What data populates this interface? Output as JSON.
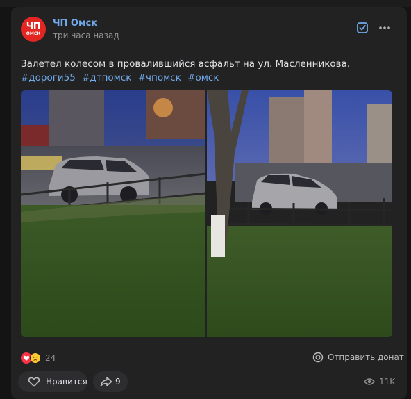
{
  "post": {
    "author": "ЧП Омск",
    "avatar_text": "ЧП",
    "avatar_subtext": "ОМСК",
    "time": "три часа назад",
    "text": "Залетел колесом в провалившийся асфальт на ул. Масленникова.",
    "hashtags": [
      "#дороги55",
      "#дтпомск",
      "#чпомск",
      "#омск"
    ]
  },
  "header_icons": [
    "save-check-icon",
    "more-dots-icon"
  ],
  "reactions": {
    "count": "24",
    "icons": [
      "heart-icon",
      "sad-emoji-icon"
    ]
  },
  "donate": {
    "label": "Отправить донат",
    "icon": "coin-icon"
  },
  "actions": {
    "like_label": "Нравится",
    "share_count": "9"
  },
  "views": {
    "count": "11K",
    "icon": "eye-icon"
  },
  "colors": {
    "accent": "#71aaeb",
    "avatar_bg": "#e32621",
    "card_bg": "#222223",
    "page_bg": "#141414"
  }
}
